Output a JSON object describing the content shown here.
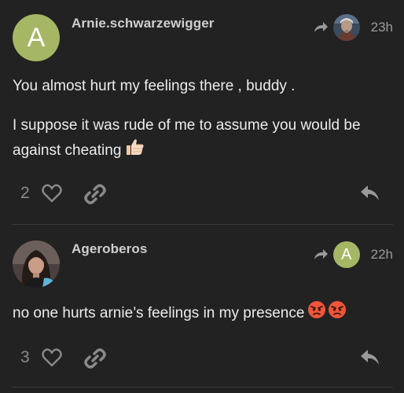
{
  "posts": [
    {
      "avatar_letter": "A",
      "username": "Arnie.schwarzewigger",
      "timestamp": "23h",
      "paragraphs": [
        "You almost hurt my feelings there , buddy .",
        "I suppose it was rude of me to assume you would be against cheating"
      ],
      "emoji": "thumbs-up",
      "like_count": "2"
    },
    {
      "username": "Ageroberos",
      "reply_to_letter": "A",
      "timestamp": "22h",
      "paragraphs": [
        "no one hurts arnie’s feelings in my presence"
      ],
      "emoji": "angry-face x2",
      "like_count": "3"
    }
  ],
  "colors": {
    "background": "#222222",
    "avatar_green": "#a5b665",
    "text": "#ececec",
    "muted": "#8a8a8a",
    "divider": "#3a3a3a"
  }
}
